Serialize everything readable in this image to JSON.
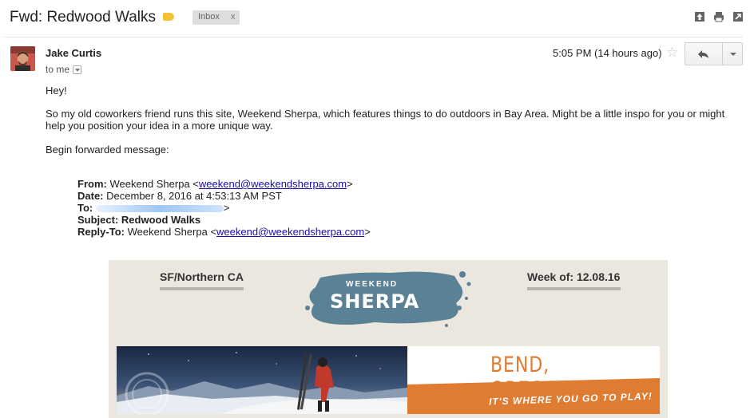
{
  "email": {
    "subject": "Fwd: Redwood Walks",
    "label_chip": "Inbox",
    "label_chip_close": "x",
    "sender_name": "Jake Curtis",
    "recipient": "to me",
    "timestamp": "5:05 PM (14 hours ago)",
    "body": {
      "greeting": "Hey!",
      "paragraph_1": "So my old coworkers friend runs this site, Weekend Sherpa, which features things to do outdoors in Bay Area. Might be a little inspo for you or might",
      "paragraph_1_cont": "help you position your idea in a more unique way.",
      "forward_intro": "Begin forwarded message:"
    },
    "forwarded": {
      "from_label": "From:",
      "from_name": "Weekend Sherpa <",
      "from_email": "weekend@weekendsherpa.com",
      "from_close": ">",
      "date_label": "Date:",
      "date_value": "December 8, 2016 at 4:53:13 AM PST",
      "to_label": "To:",
      "to_close": ">",
      "subject_label": "Subject:",
      "subject_value": "Redwood Walks",
      "replyto_label": "Reply-To:",
      "replyto_name": "Weekend Sherpa <",
      "replyto_email": "weekend@weekendsherpa.com",
      "replyto_close": ">"
    }
  },
  "newsletter": {
    "region": "SF/Northern CA",
    "week": "Week of: 12.08.16",
    "logo_small": "WEEKEND",
    "logo_big": "SHERPA",
    "banner_title": "BEND, OREGON",
    "banner_tagline": "IT'S WHERE YOU GO TO PLAY!"
  },
  "icons": {
    "label": "label-tag-icon",
    "archive": "archive-icon",
    "print": "print-icon",
    "new_window": "new-window-icon",
    "star": "star-icon",
    "reply": "reply-icon",
    "more": "more-options-icon"
  },
  "colors": {
    "label_tag": "#f2c233",
    "link": "#1a0dab",
    "banner_orange": "#e07b32",
    "logo_blue": "#5b8196",
    "newsletter_bg": "#ebe6de"
  }
}
